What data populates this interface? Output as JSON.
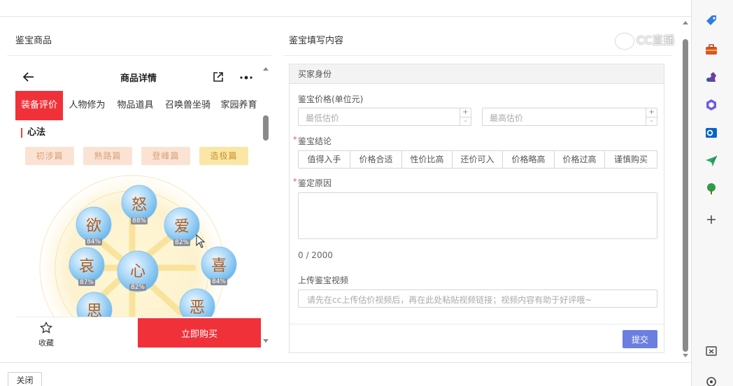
{
  "left_section": {
    "title": "鉴宝商品"
  },
  "right_section": {
    "title": "鉴宝填写内容"
  },
  "phone": {
    "header_title": "商品详情",
    "tabs": [
      {
        "label": "装备评价",
        "active": true
      },
      {
        "label": "人物修为",
        "active": false
      },
      {
        "label": "物品道具",
        "active": false
      },
      {
        "label": "召唤兽坐骑",
        "active": false
      },
      {
        "label": "家园养育",
        "active": false
      }
    ],
    "section_title": "心法",
    "pills": [
      {
        "label": "初涉篇",
        "selected": false
      },
      {
        "label": "熟路篇",
        "selected": false
      },
      {
        "label": "登峰篇",
        "selected": false
      },
      {
        "label": "造极篇",
        "selected": true
      }
    ],
    "emotions": [
      {
        "char": "怒",
        "pct": "88%"
      },
      {
        "char": "欲",
        "pct": "84%"
      },
      {
        "char": "爱",
        "pct": "82%"
      },
      {
        "char": "哀",
        "pct": "87%"
      },
      {
        "char": "心",
        "pct": "82%"
      },
      {
        "char": "喜",
        "pct": "84%"
      },
      {
        "char": "思",
        "pct": ""
      },
      {
        "char": "恶",
        "pct": ""
      }
    ],
    "favorite_label": "收藏",
    "buy_label": "立即购买"
  },
  "form": {
    "header": "买家身份",
    "price_label": "鉴宝价格(单位元)",
    "min_placeholder": "最低估价",
    "max_placeholder": "最高估价",
    "conclusion_label": "鉴宝结论",
    "conclusion_options": [
      "值得入手",
      "价格合适",
      "性价比高",
      "还价可入",
      "价格略高",
      "价格过高",
      "谨慎购买"
    ],
    "reason_label": "鉴定原因",
    "char_count": "0 / 2000",
    "video_label": "上传鉴宝视频",
    "video_placeholder": "请先在cc上传估价视频后，再在此处粘贴视频链接；视频内容有助于好评哦~",
    "submit_label": "提交"
  },
  "watermark": "CC直播",
  "footer": {
    "close_label": "关闭"
  },
  "colors": {
    "accent_red": "#f0313a",
    "submit_blue": "#6b7fe0"
  },
  "sidebar_icons": [
    "tag-icon",
    "briefcase-icon",
    "chess-icon",
    "copilot-icon",
    "outlook-icon",
    "send-icon",
    "tree-icon",
    "plus-icon",
    "screenshot-icon",
    "settings-icon"
  ]
}
